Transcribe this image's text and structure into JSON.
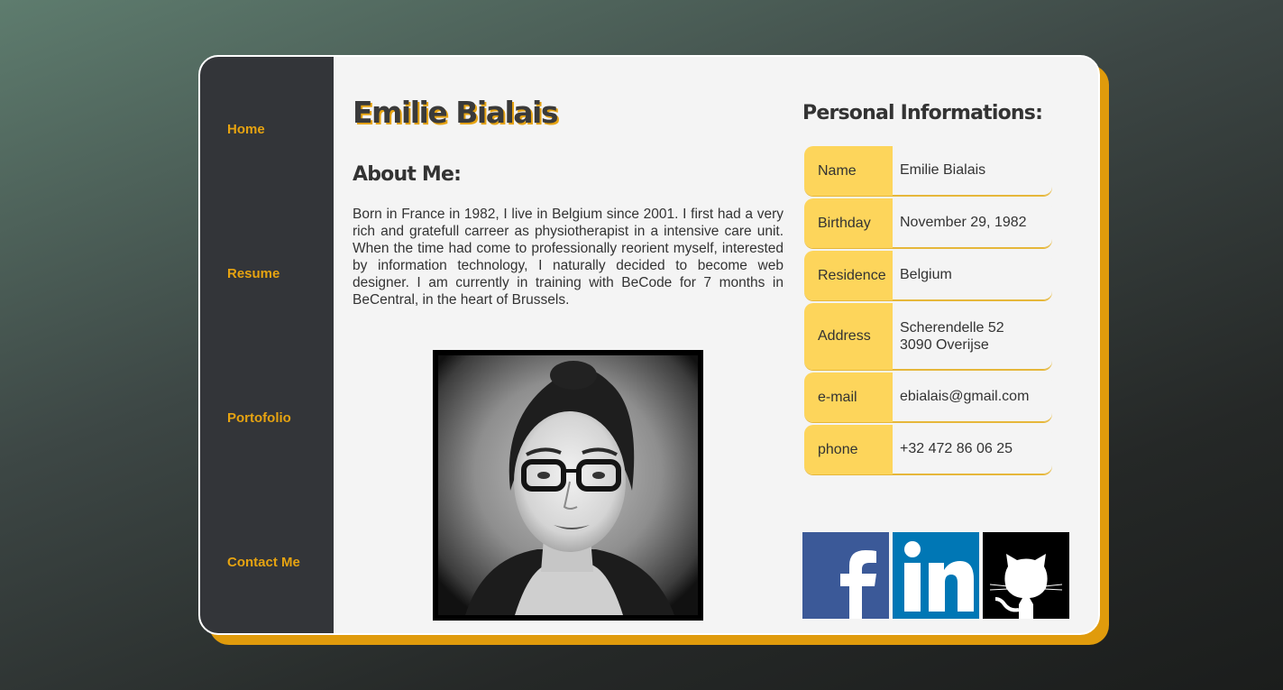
{
  "nav": {
    "home": "Home",
    "resume": "Resume",
    "portfolio": "Portofolio",
    "contact": "Contact Me"
  },
  "profile": {
    "name": "Emilie Bialais",
    "about_title": "About Me:",
    "about_text": "Born in France in 1982, I live in Belgium since 2001. I first had a very rich and gratefull carreer as physiotherapist in a intensive care unit. When the time had come to professionally reorient myself, interested by information technology, I naturally decided to become web designer. I am currently in training with BeCode for 7 months in BeCentral, in the heart of Brussels."
  },
  "info": {
    "title": "Personal Informations:",
    "rows": [
      {
        "label": "Name",
        "value": "Emilie Bialais"
      },
      {
        "label": "Birthday",
        "value": "November 29, 1982"
      },
      {
        "label": "Residence",
        "value": "Belgium"
      },
      {
        "label": "Address",
        "value_line1": "Scherendelle 52",
        "value_line2": "3090 Overijse"
      },
      {
        "label": "e-mail",
        "value": "ebialais@gmail.com"
      },
      {
        "label": "phone",
        "value": "+32 472 86 06 25"
      }
    ]
  },
  "social": {
    "facebook_icon": "facebook-icon",
    "linkedin_icon": "linkedin-icon",
    "github_icon": "github-icon"
  },
  "colors": {
    "accent": "#e6a311",
    "sidebar": "#333539",
    "card": "#f4f4f4",
    "label_bg": "#fdd55b",
    "facebook": "#3b5998",
    "linkedin": "#0077b5"
  }
}
